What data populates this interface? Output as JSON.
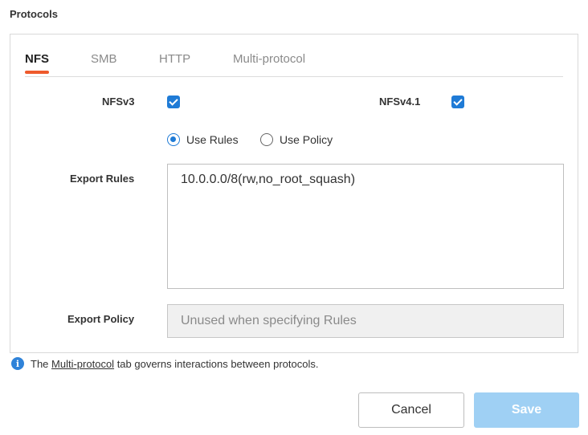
{
  "section_title": "Protocols",
  "tabs": [
    {
      "label": "NFS",
      "active": true
    },
    {
      "label": "SMB",
      "active": false
    },
    {
      "label": "HTTP",
      "active": false
    },
    {
      "label": "Multi-protocol",
      "active": false
    }
  ],
  "nfs": {
    "nfsv3_label": "NFSv3",
    "nfsv3_checked": true,
    "nfsv41_label": "NFSv4.1",
    "nfsv41_checked": true,
    "mode_options": [
      {
        "label": "Use Rules",
        "selected": true
      },
      {
        "label": "Use Policy",
        "selected": false
      }
    ],
    "export_rules_label": "Export Rules",
    "export_rules_value": "10.0.0.0/8(rw,no_root_squash)",
    "export_policy_label": "Export Policy",
    "export_policy_placeholder": "Unused when specifying Rules"
  },
  "info": {
    "prefix": "The",
    "link": "Multi-protocol",
    "suffix": "tab governs interactions between protocols."
  },
  "buttons": {
    "cancel": "Cancel",
    "save": "Save"
  },
  "colors": {
    "accent": "#1f7bd6",
    "tab_indicator": "#ee5a2c",
    "save_disabled": "#9fd0f4"
  }
}
